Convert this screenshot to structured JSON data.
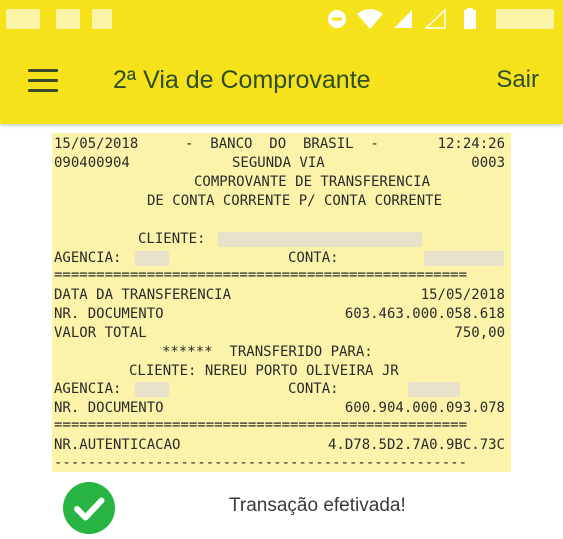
{
  "app_bar": {
    "title": "2ª Via de Comprovante",
    "logout_label": "Sair",
    "background_color": "#f5e21b",
    "text_color": "#2e4d2a"
  },
  "status_bar": {
    "icons": [
      "dnd-icon",
      "wifi-icon",
      "signal-icon",
      "signal-empty-icon",
      "battery-icon"
    ]
  },
  "receipt": {
    "background_color": "#fbf3a9",
    "header_date": "15/05/2018",
    "header_bank": "-  BANCO  DO  BRASIL  -",
    "header_time": "12:24:26",
    "header_code": "090400904",
    "header_copy": "SEGUNDA VIA",
    "header_seq": "0003",
    "title_line1": "COMPROVANTE DE TRANSFERENCIA",
    "title_line2": "DE CONTA CORRENTE P/ CONTA CORRENTE",
    "client_label": "CLIENTE:",
    "agency_label": "AGENCIA:",
    "account_label": "CONTA:",
    "separator_double": "=================================================",
    "separator_single": "-------------------------------------------------",
    "transfer_date_label": "DATA DA TRANSFERENCIA",
    "transfer_date_value": "15/05/2018",
    "doc_number_label": "NR. DOCUMENTO",
    "doc_number_value": "603.463.000.058.618",
    "total_value_label": "VALOR TOTAL",
    "total_value": "750,00",
    "transferred_to_label": "******  TRANSFERIDO PARA:",
    "recipient_line": "CLIENTE: NEREU PORTO OLIVEIRA JR",
    "recipient_agency_label": "AGENCIA:",
    "recipient_account_label": "CONTA:",
    "recipient_doc_label": "NR. DOCUMENTO",
    "recipient_doc_value": "600.904.000.093.078",
    "auth_label": "NR.AUTENTICACAO",
    "auth_value": "4.D78.5D2.7A0.9BC.73C"
  },
  "status": {
    "message": "Transação efetivada!",
    "icon": "check-circle-icon",
    "color": "#27b443"
  }
}
